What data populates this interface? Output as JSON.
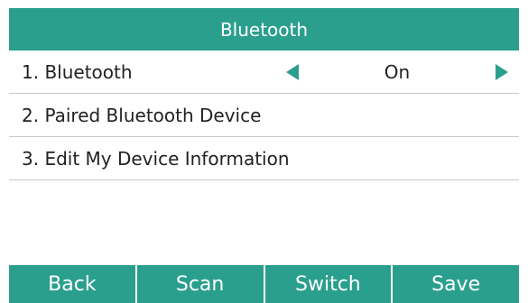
{
  "colors": {
    "accent": "#2b9f8e",
    "text": "#222222",
    "divider": "#c9c9c9",
    "background": "#ffffff"
  },
  "title": "Bluetooth",
  "menu": {
    "items": [
      {
        "label": "1. Bluetooth",
        "value": "On"
      },
      {
        "label": "2. Paired Bluetooth Device"
      },
      {
        "label": "3. Edit My Device Information"
      }
    ],
    "value_icons": [
      "arrow-left-icon",
      "arrow-right-icon"
    ]
  },
  "softkeys": {
    "back": "Back",
    "scan": "Scan",
    "switch": "Switch",
    "save": "Save"
  }
}
